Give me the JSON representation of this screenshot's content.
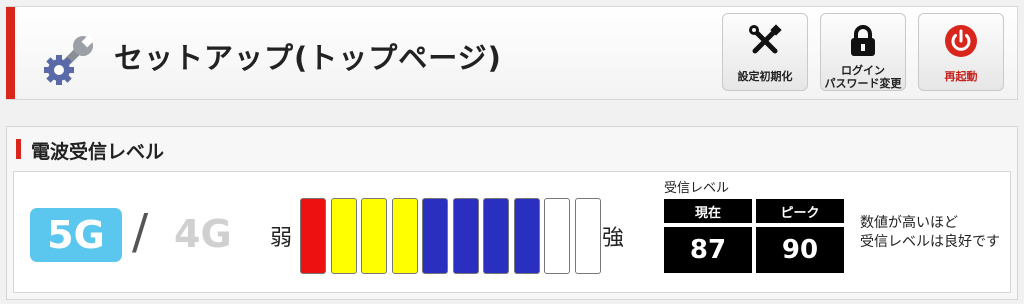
{
  "header": {
    "title": "セットアップ(トップページ)",
    "icon": "tools-settings-icon",
    "accent_color": "#d9261c",
    "buttons": [
      {
        "label": "設定初期化",
        "icon": "wrench-screwdriver-icon"
      },
      {
        "label_line1": "ログイン",
        "label_line2": "パスワード変更",
        "icon": "lock-icon"
      },
      {
        "label": "再起動",
        "icon": "power-icon",
        "color": "#c6221b"
      }
    ]
  },
  "signal_panel": {
    "title": "電波受信レベル",
    "mode_active": "5G",
    "separator": "/",
    "mode_inactive": "4G",
    "weak_label": "弱",
    "strong_label": "強",
    "bars": [
      {
        "color": "#ee1111"
      },
      {
        "color": "#ffff00"
      },
      {
        "color": "#ffff00"
      },
      {
        "color": "#ffff00"
      },
      {
        "color": "#2b2fbf"
      },
      {
        "color": "#2b2fbf"
      },
      {
        "color": "#2b2fbf"
      },
      {
        "color": "#2b2fbf"
      },
      {
        "color": "#ffffff"
      },
      {
        "color": "#ffffff"
      }
    ],
    "level": {
      "title": "受信レベル",
      "current_label": "現在",
      "peak_label": "ピーク",
      "current_value": "87",
      "peak_value": "90"
    },
    "note_line1": "数値が高いほど",
    "note_line2": "受信レベルは良好です",
    "colors": {
      "active_mode_bg": "#5cc7ee",
      "inactive_mode_text": "#d0d0d0"
    }
  }
}
